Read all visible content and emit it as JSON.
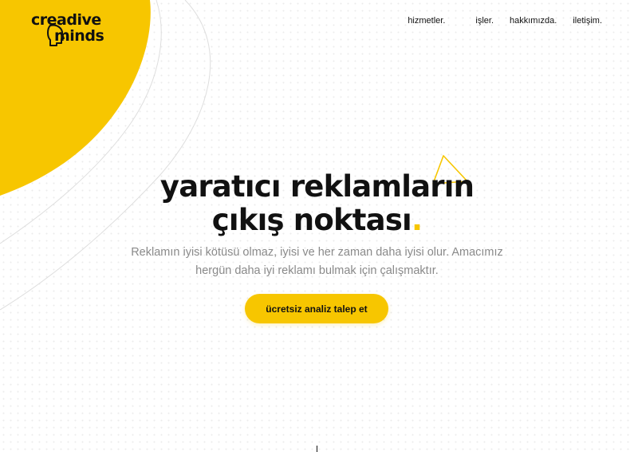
{
  "brand": {
    "logo_top": "creadive",
    "logo_bottom": "minds",
    "accent": "#f7c600"
  },
  "nav": {
    "items": [
      {
        "label": "hizmetler."
      },
      {
        "label": "işler."
      },
      {
        "label": "hakkımızda."
      },
      {
        "label": "iletişim."
      }
    ]
  },
  "hero": {
    "title_line1": "yaratıcı reklamların",
    "title_line2": "çıkış noktası",
    "title_dot": ".",
    "subtitle": "Reklamın iyisi kötüsü olmaz, iyisi ve her zaman daha iyisi olur. Amacımız hergün daha iyi reklamı bulmak için çalışmaktır.",
    "cta_label": "ücretsiz analiz talep et"
  },
  "icons": {
    "decor_triangle": "triangle-outline-icon",
    "logo_mark": "head-profile-icon"
  }
}
